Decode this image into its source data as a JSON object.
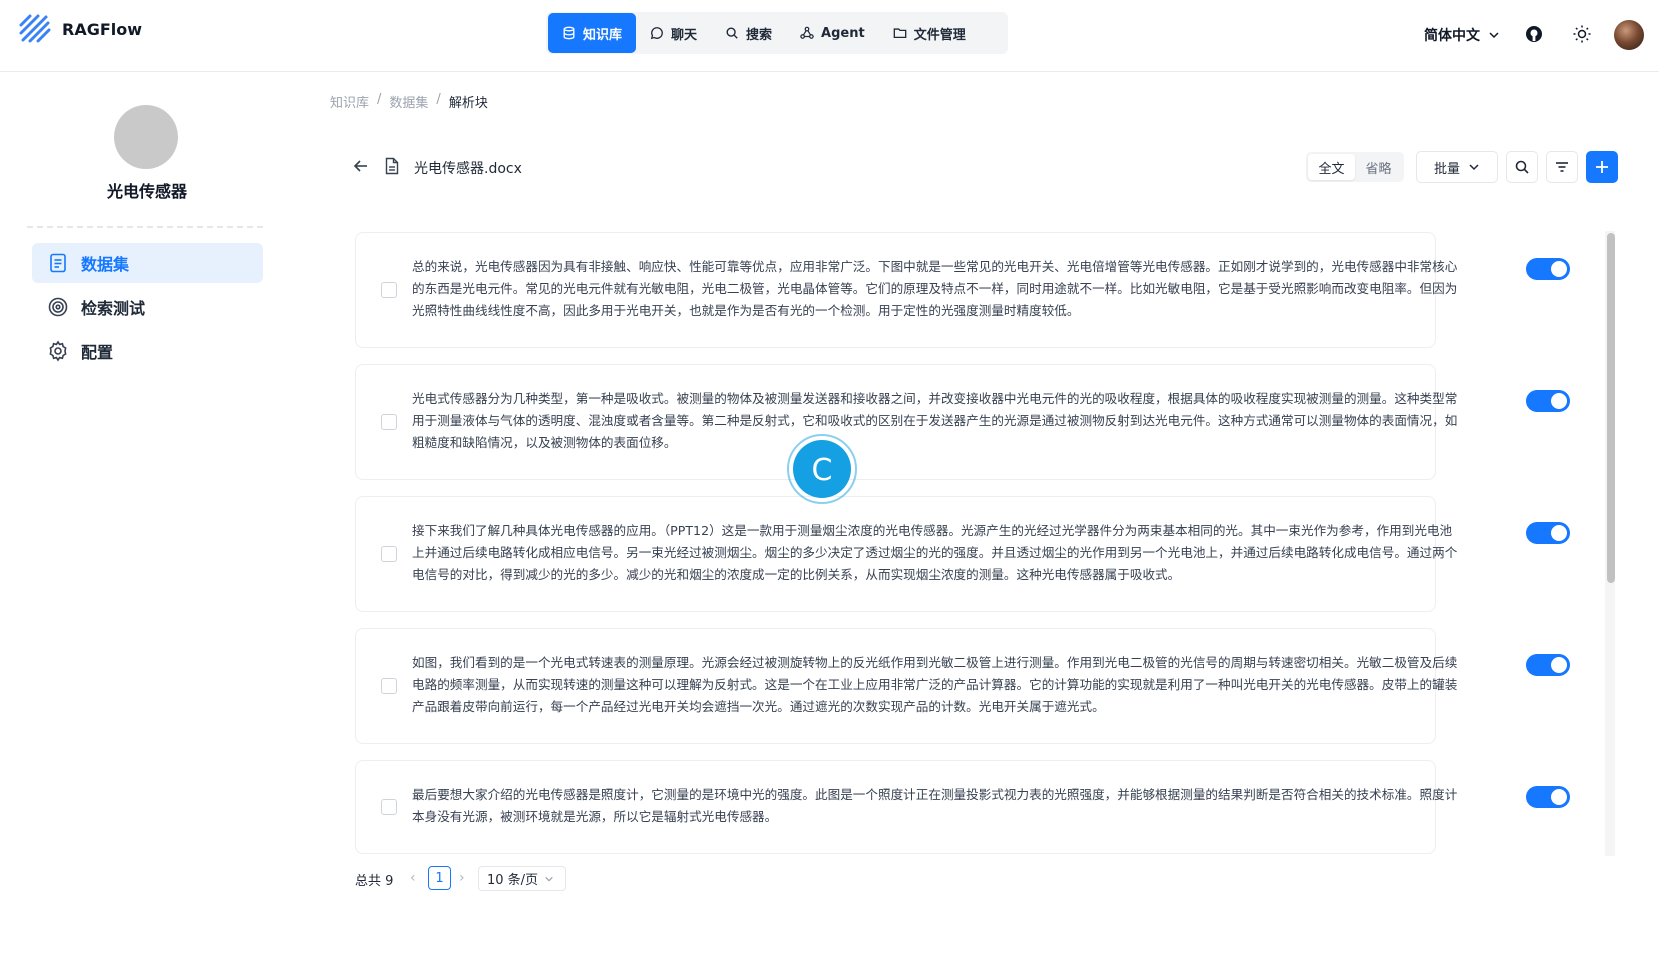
{
  "header": {
    "app_title": "RAGFlow",
    "nav": [
      {
        "label": "知识库",
        "icon": "database-icon",
        "active": true
      },
      {
        "label": "聊天",
        "icon": "chat-bubble-icon",
        "active": false
      },
      {
        "label": "搜索",
        "icon": "search-icon",
        "active": false
      },
      {
        "label": "Agent",
        "icon": "agent-graph-icon",
        "active": false
      },
      {
        "label": "文件管理",
        "icon": "folder-icon",
        "active": false
      }
    ],
    "language": "简体中文",
    "accent_color": "#1677ff"
  },
  "sidebar": {
    "kb_name": "光电传感器",
    "items": [
      {
        "label": "数据集",
        "icon": "dataset-icon",
        "active": true
      },
      {
        "label": "检索测试",
        "icon": "target-icon",
        "active": false
      },
      {
        "label": "配置",
        "icon": "gear-icon",
        "active": false
      }
    ]
  },
  "breadcrumb": [
    "知识库",
    "数据集",
    "解析块"
  ],
  "document": {
    "name": "光电传感器.docx"
  },
  "toolbar": {
    "view_full": "全文",
    "view_brief": "省略",
    "batch": "批量"
  },
  "chunks": [
    {
      "text": "总的来说，光电传感器因为具有非接触、响应快、性能可靠等优点，应用非常广泛。下图中就是一些常见的光电开关、光电倍增管等光电传感器。正如刚才说学到的，光电传感器中非常核心的东西是光电元件。常见的光电元件就有光敏电阻，光电二极管，光电晶体管等。它们的原理及特点不一样，同时用途就不一样。比如光敏电阻，它是基于受光照影响而改变电阻率。但因为光照特性曲线线性度不高，因此多用于光电开关，也就是作为是否有光的一个检测。用于定性的光强度测量时精度较低。",
      "enabled": true
    },
    {
      "text": "光电式传感器分为几种类型，第一种是吸收式。被测量的物体及被测量发送器和接收器之间，并改变接收器中光电元件的光的吸收程度，根据具体的吸收程度实现被测量的测量。这种类型常用于测量液体与气体的透明度、混浊度或者含量等。第二种是反射式，它和吸收式的区别在于发送器产生的光源是通过被测物反射到达光电元件。这种方式通常可以测量物体的表面情况，如粗糙度和缺陷情况，以及被测物体的表面位移。",
      "enabled": true
    },
    {
      "text": "接下来我们了解几种具体光电传感器的应用。（PPT12）这是一款用于测量烟尘浓度的光电传感器。光源产生的光经过光学器件分为两束基本相同的光。其中一束光作为参考，作用到光电池上并通过后续电路转化成相应电信号。另一束光经过被测烟尘。烟尘的多少决定了透过烟尘的光的强度。并且透过烟尘的光作用到另一个光电池上，并通过后续电路转化成电信号。通过两个电信号的对比，得到减少的光的多少。减少的光和烟尘的浓度成一定的比例关系，从而实现烟尘浓度的测量。这种光电传感器属于吸收式。",
      "enabled": true
    },
    {
      "text": "如图，我们看到的是一个光电式转速表的测量原理。光源会经过被测旋转物上的反光纸作用到光敏二极管上进行测量。作用到光电二极管的光信号的周期与转速密切相关。光敏二极管及后续电路的频率测量，从而实现转速的测量这种可以理解为反射式。这是一个在工业上应用非常广泛的产品计算器。它的计算功能的实现就是利用了一种叫光电开关的光电传感器。皮带上的罐装产品跟着皮带向前运行，每一个产品经过光电开关均会遮挡一次光。通过遮光的次数实现产品的计数。光电开关属于遮光式。",
      "enabled": true
    },
    {
      "text": "最后要想大家介绍的光电传感器是照度计，它测量的是环境中光的强度。此图是一个照度计正在测量投影式视力表的光照强度，并能够根据测量的结果判断是否符合相关的技术标准。照度计本身没有光源，被测环境就是光源，所以它是辐射式光电传感器。",
      "enabled": true
    }
  ],
  "pagination": {
    "total": "总共 9",
    "current": "1",
    "page_size": "10 条/页"
  },
  "loader": {
    "glyph": "C"
  }
}
